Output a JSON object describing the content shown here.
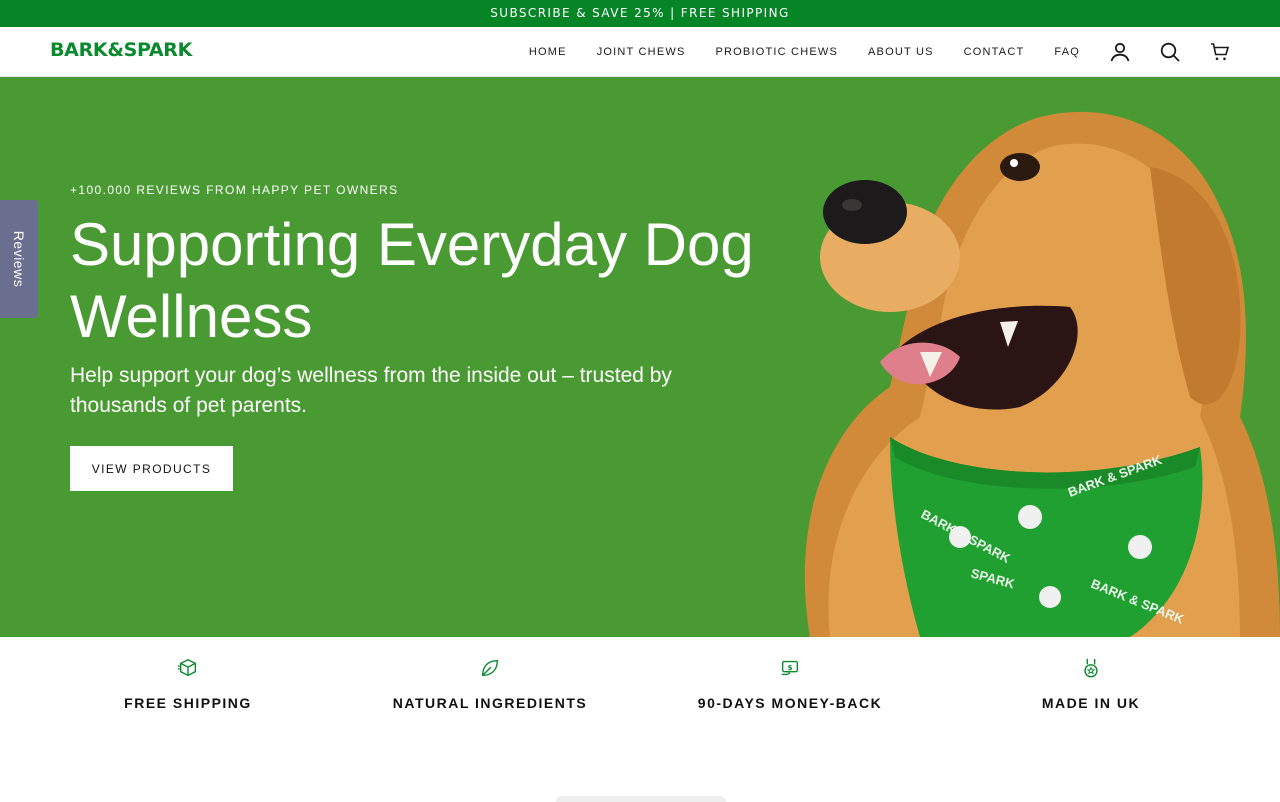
{
  "announcement": "SUBSCRIBE & SAVE 25% | FREE SHIPPING",
  "brand": {
    "logo": "BARK&SPARK",
    "color": "#0a8a2e"
  },
  "nav": {
    "items": [
      {
        "label": "HOME"
      },
      {
        "label": "JOINT CHEWS"
      },
      {
        "label": "PROBIOTIC CHEWS"
      },
      {
        "label": "ABOUT US"
      },
      {
        "label": "CONTACT"
      },
      {
        "label": "FAQ"
      }
    ],
    "icons": [
      "account-icon",
      "search-icon",
      "cart-icon"
    ]
  },
  "hero": {
    "eyebrow": "+100.000 REVIEWS FROM HAPPY PET OWNERS",
    "title": "Supporting Everyday Dog Wellness",
    "subtitle": "Help support your dog’s wellness from the inside out – trusted by thousands of pet parents.",
    "cta": "VIEW PRODUCTS",
    "background": "#4a9a33"
  },
  "reviews_tab": {
    "label": "Reviews",
    "color": "#6b6f8f"
  },
  "features": [
    {
      "label": "FREE SHIPPING",
      "icon": "box-icon"
    },
    {
      "label": "NATURAL INGREDIENTS",
      "icon": "leaf-icon"
    },
    {
      "label": "90-DAYS MONEY-BACK",
      "icon": "money-back-icon"
    },
    {
      "label": "MADE IN UK",
      "icon": "medal-icon"
    }
  ]
}
